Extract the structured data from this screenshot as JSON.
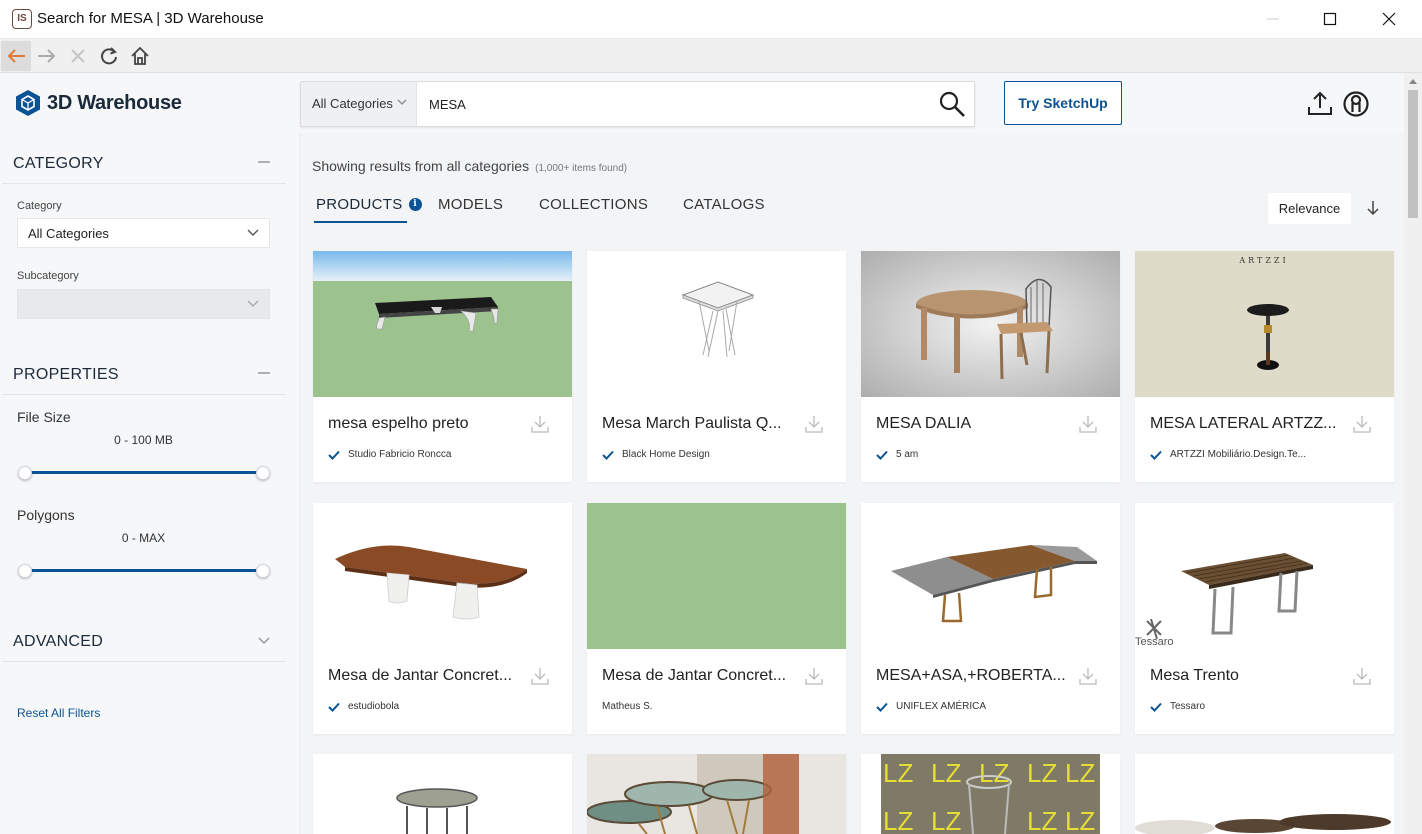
{
  "window": {
    "app_icon": "IS",
    "title": "Search for MESA | 3D Warehouse"
  },
  "header": {
    "logo": "3D Warehouse",
    "category_select": "All Categories",
    "search_value": "MESA",
    "try_button": "Try SketchUp"
  },
  "sidebar": {
    "category_heading": "CATEGORY",
    "category_label": "Category",
    "category_value": "All Categories",
    "subcategory_label": "Subcategory",
    "subcategory_value": "",
    "properties_heading": "PROPERTIES",
    "file_size_label": "File Size",
    "file_size_range": "0 - 100 MB",
    "polygons_label": "Polygons",
    "polygons_range": "0 - MAX",
    "advanced_heading": "ADVANCED",
    "reset_link": "Reset All Filters"
  },
  "main": {
    "showing": "Showing results from all categories",
    "count": "(1,000+ items found)",
    "tabs": [
      "PRODUCTS",
      "MODELS",
      "COLLECTIONS",
      "CATALOGS"
    ],
    "info_icon": "i",
    "sort": "Relevance",
    "cards": [
      {
        "title": "mesa espelho preto",
        "author": "Studio Fabricio Roncca",
        "verified": true
      },
      {
        "title": "Mesa March Paulista Q...",
        "author": "Black Home Design",
        "verified": true
      },
      {
        "title": "MESA DALIA",
        "author": "5 am",
        "verified": true
      },
      {
        "title": "MESA LATERAL ARTZZ...",
        "author": "ARTZZI Mobiliário.Design.Te...",
        "verified": true,
        "brand_text": "ARTZZI"
      },
      {
        "title": "Mesa de Jantar Concret...",
        "author": "estudiobola",
        "verified": true
      },
      {
        "title": "Mesa de Jantar Concret...",
        "author": "Matheus S.",
        "verified": false
      },
      {
        "title": "MESA+ASA,+ROBERTA...",
        "author": "UNIFLEX AMÉRICA",
        "verified": true
      },
      {
        "title": "Mesa Trento",
        "author": "Tessaro",
        "verified": true,
        "brand_text": "Tessaro"
      }
    ],
    "partial_brand_text": "LZ"
  },
  "colors": {
    "accent": "#0b5394",
    "sidebar_bg": "#f6f7f9",
    "main_bg": "#f3f4f6"
  }
}
